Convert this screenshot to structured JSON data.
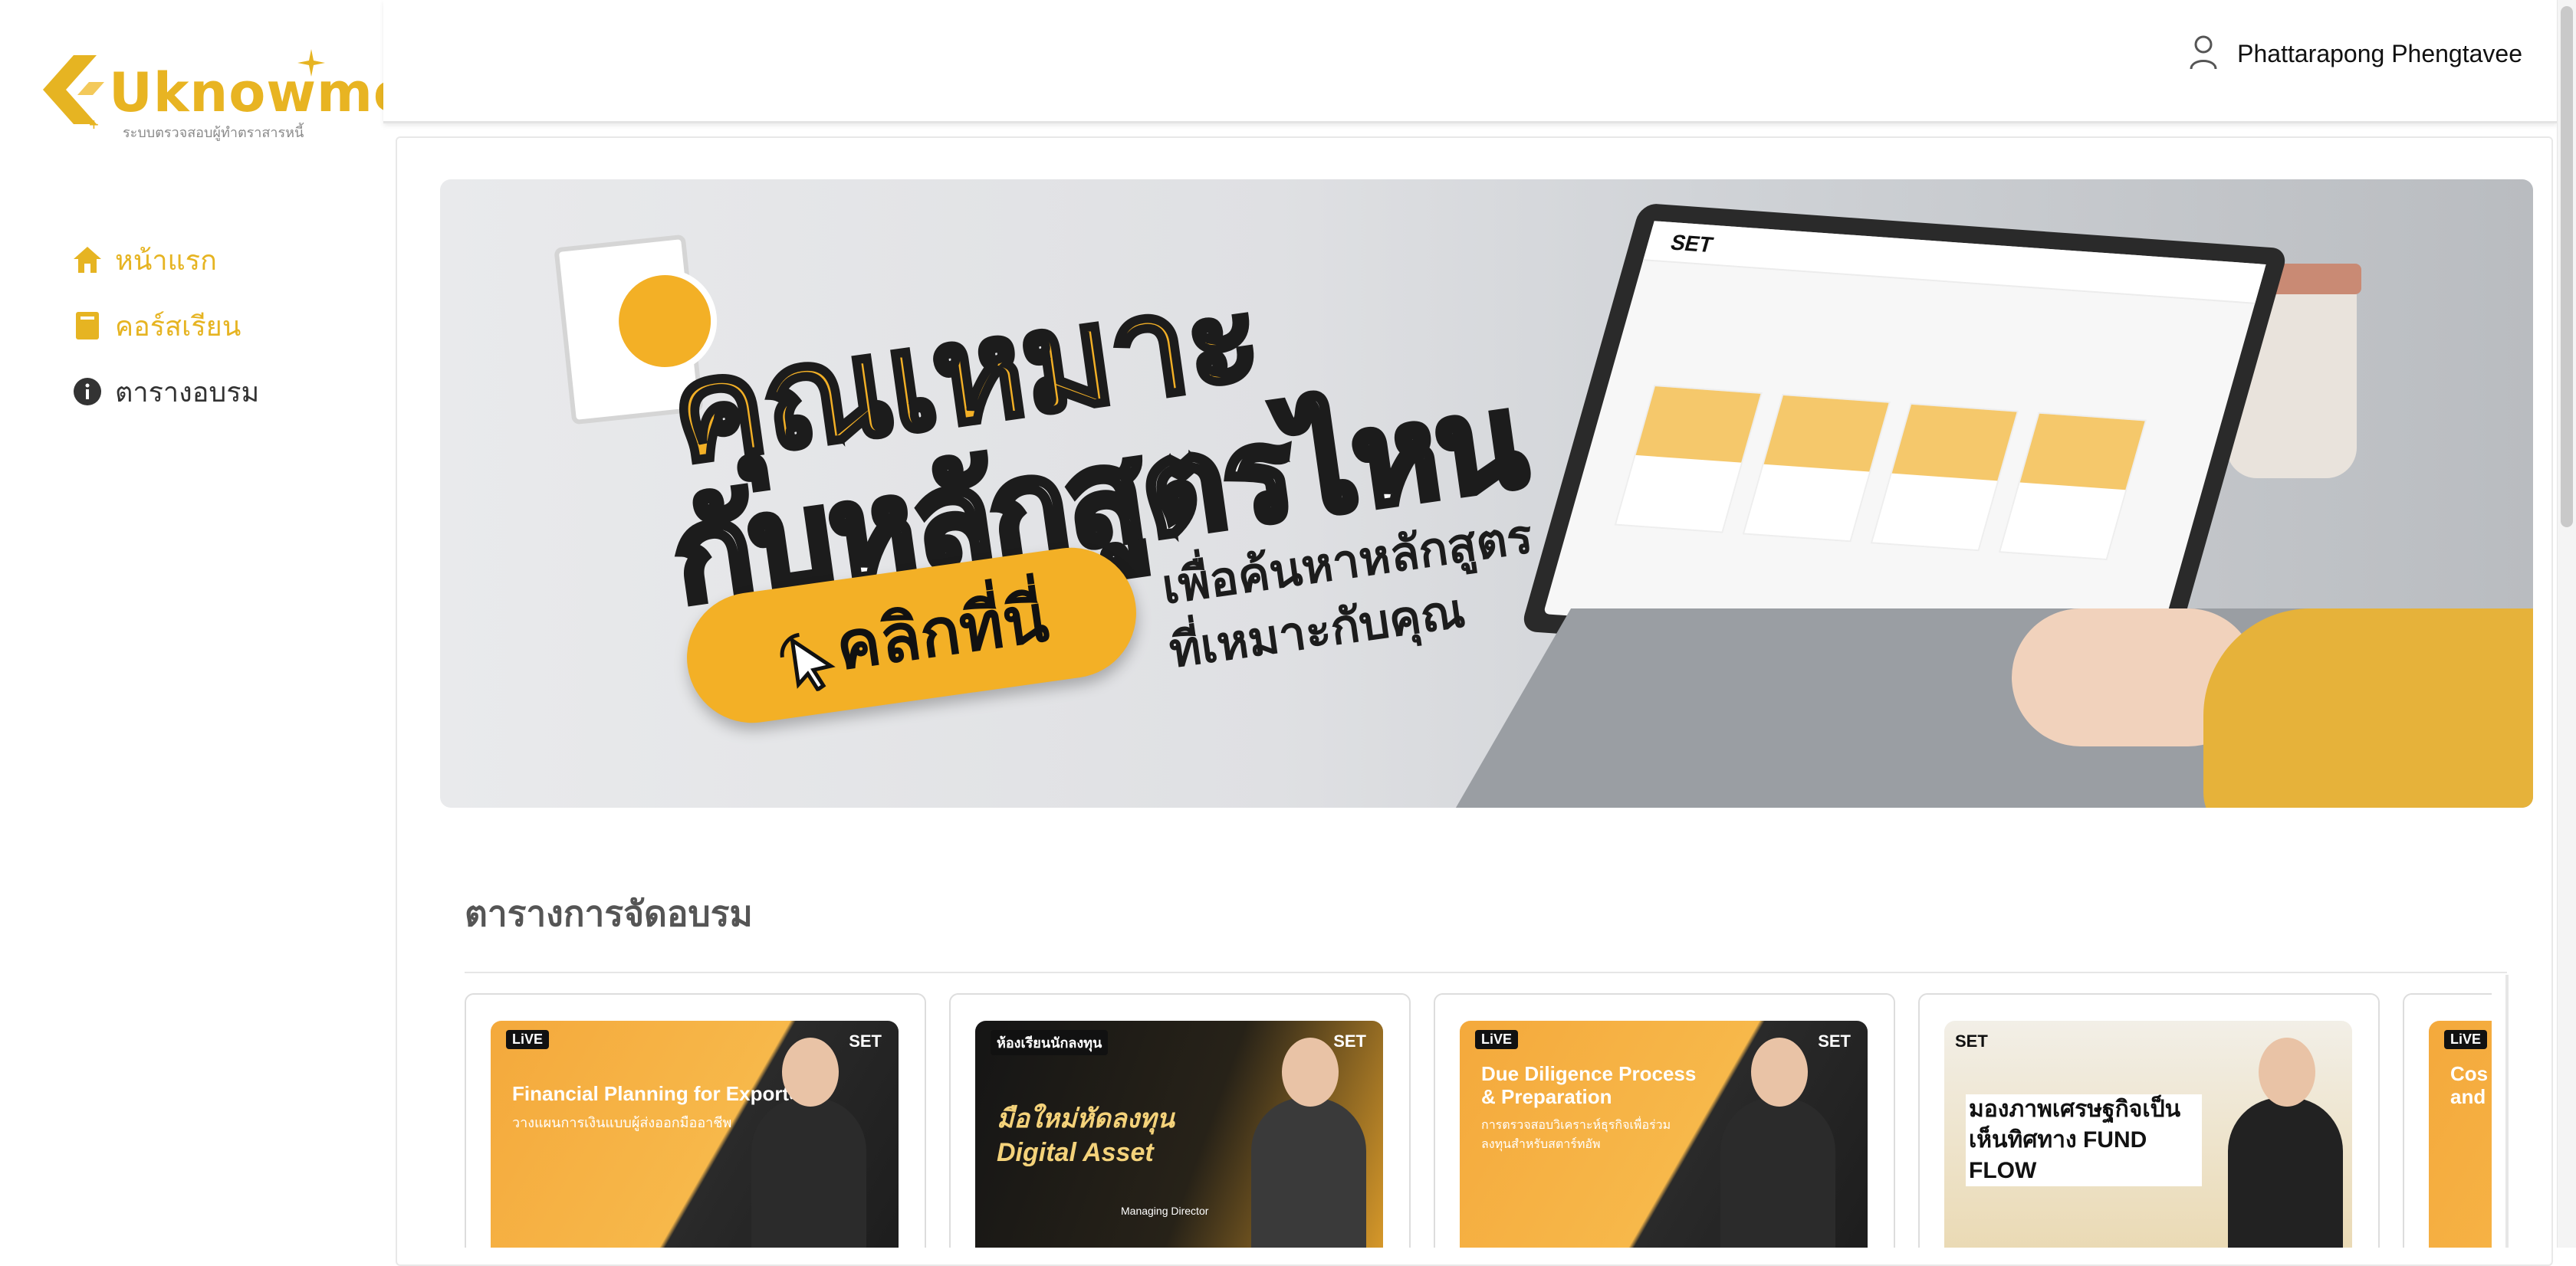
{
  "app": {
    "logo_text": "Uknowme",
    "logo_subtitle": "ระบบตรวจสอบผู้ทำตราสารหนี้"
  },
  "colors": {
    "accent": "#e6b422",
    "text_dark": "#333333",
    "banner_yellow": "#f3b026"
  },
  "sidebar": {
    "items": [
      {
        "label": "หน้าแรก",
        "icon": "home-icon"
      },
      {
        "label": "คอร์สเรียน",
        "icon": "book-icon"
      },
      {
        "label": "ตารางอบรม",
        "icon": "info-icon"
      }
    ]
  },
  "header": {
    "user_name": "Phattarapong Phengtavee",
    "user_icon": "user-icon"
  },
  "banner": {
    "headline_line1": "คุณเหมาะ",
    "headline_line2": "กับหลักสูตรไหน",
    "cta_label": "คลิกที่นี่",
    "sub_line1": "เพื่อค้นหาหลักสูตร",
    "sub_line2": "ที่เหมาะกับคุณ",
    "laptop_brand": "SET"
  },
  "section": {
    "title": "ตารางการจัดอบรม"
  },
  "courses": [
    {
      "badge": "SET",
      "live": "LiVE",
      "title": "Financial Planning for Exporters",
      "subtitle": "วางแผนการเงินแบบผู้ส่งออกมืออาชีพ"
    },
    {
      "badge": "SET",
      "live": "ห้องเรียนนักลงทุน",
      "title": "มือใหม่หัดลงทุน Digital Asset",
      "subtitle": "Managing Director"
    },
    {
      "badge": "SET",
      "live": "LiVE",
      "title": "Due Diligence Process & Preparation",
      "subtitle": "การตรวจสอบวิเคราะห์ธุรกิจเพื่อร่วมลงทุนสำหรับสตาร์ทอัพ"
    },
    {
      "badge": "SET",
      "live": "",
      "title": "มองภาพเศรษฐกิจเป็น เห็นทิศทาง FUND FLOW",
      "subtitle": ""
    },
    {
      "badge": "",
      "live": "LiVE",
      "title": "Cos and",
      "subtitle": ""
    }
  ]
}
